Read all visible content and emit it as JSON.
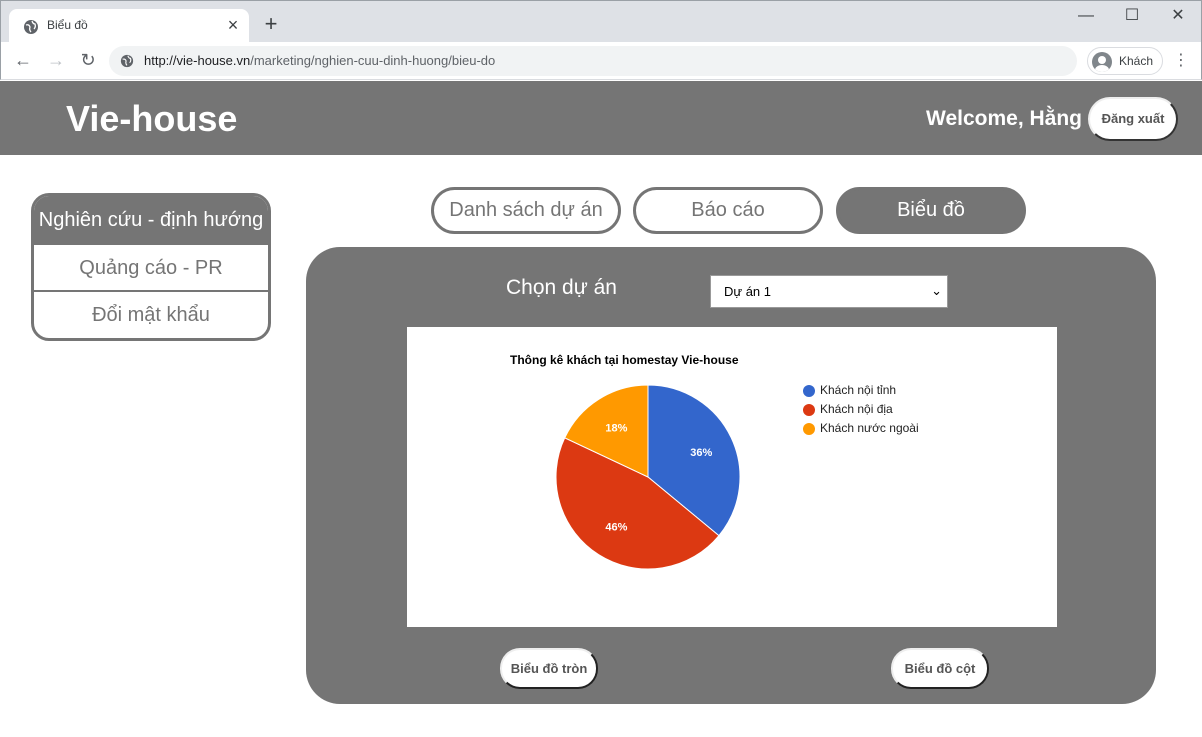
{
  "browser": {
    "tab_title": "Biểu đồ",
    "url_host": "http://vie-house.vn",
    "url_path": "/marketing/nghien-cuu-dinh-huong/bieu-do",
    "profile_label": "Khách"
  },
  "header": {
    "brand": "Vie-house",
    "welcome": "Welcome, Hằng",
    "logout_label": "Đăng xuất"
  },
  "sidebar": {
    "items": [
      {
        "label": "Nghiên cứu - định hướng"
      },
      {
        "label": "Quảng cáo - PR"
      },
      {
        "label": "Đổi mật khẩu"
      }
    ]
  },
  "tabs": [
    {
      "label": "Danh sách dự án"
    },
    {
      "label": "Báo cáo"
    },
    {
      "label": "Biểu đồ"
    }
  ],
  "panel": {
    "choose_label": "Chọn dự án",
    "project_select": "Dự án 1",
    "pie_button": "Biểu đồ tròn",
    "bar_button": "Biểu đồ cột"
  },
  "colors": {
    "brand_gray": "#757575",
    "slice_blue": "#3366cc",
    "slice_red": "#dc3912",
    "slice_orange": "#ff9900"
  },
  "chart_data": {
    "type": "pie",
    "title": "Thông kê khách tại homestay Vie-house",
    "categories": [
      "Khách nội tỉnh",
      "Khách nội địa",
      "Khách nước ngoài"
    ],
    "values": [
      36,
      46,
      18
    ],
    "labels": [
      "36%",
      "46%",
      "18%"
    ],
    "colors": [
      "#3366cc",
      "#dc3912",
      "#ff9900"
    ],
    "legend": "right"
  }
}
